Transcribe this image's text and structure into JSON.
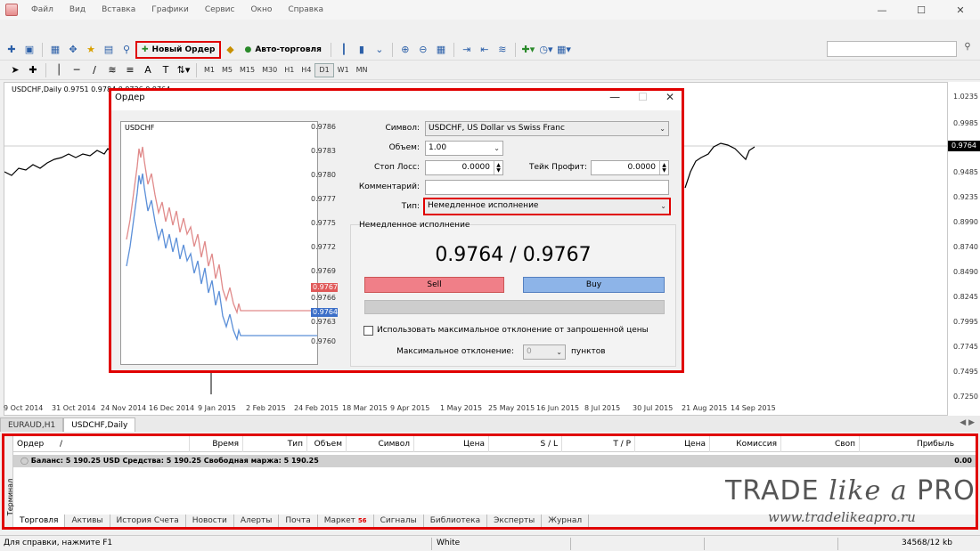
{
  "menu": [
    "Файл",
    "Вид",
    "Вставка",
    "Графики",
    "Сервис",
    "Окно",
    "Справка"
  ],
  "toolbar": {
    "new_order": "Новый Ордер",
    "auto_trading": "Авто-торговля",
    "timeframes": [
      "M1",
      "M5",
      "M15",
      "M30",
      "H1",
      "H4",
      "D1",
      "W1",
      "MN"
    ],
    "active_timeframe": "D1"
  },
  "chart": {
    "title": "USDCHF,Daily  0.9751 0.9784 0.9736 0.9764",
    "price_ticks": [
      "1.0235",
      "0.9985",
      "0.9764",
      "0.9485",
      "0.9235",
      "0.8990",
      "0.8740",
      "0.8490",
      "0.8245",
      "0.7995",
      "0.7745",
      "0.7495",
      "0.7250"
    ],
    "current_price": "0.9764",
    "dates": [
      "9 Oct 2014",
      "31 Oct 2014",
      "24 Nov 2014",
      "16 Dec 2014",
      "9 Jan 2015",
      "2 Feb 2015",
      "24 Feb 2015",
      "18 Mar 2015",
      "9 Apr 2015",
      "1 May 2015",
      "25 May 2015",
      "16 Jun 2015",
      "8 Jul 2015",
      "30 Jul 2015",
      "21 Aug 2015",
      "14 Sep 2015"
    ],
    "tabs": [
      "EURAUD,H1",
      "USDCHF,Daily"
    ],
    "active_tab": "USDCHF,Daily"
  },
  "dialog": {
    "title": "Ордер",
    "mini_chart": {
      "symbol": "USDCHF",
      "prices": [
        "0.9786",
        "0.9783",
        "0.9780",
        "0.9777",
        "0.9775",
        "0.9772",
        "0.9769",
        "0.9766",
        "0.9763",
        "0.9760"
      ],
      "ask": "0.9767",
      "bid": "0.9764"
    },
    "labels": {
      "symbol": "Символ:",
      "volume": "Объем:",
      "stop_loss": "Стоп Лосс:",
      "take_profit": "Тейк Профит:",
      "comment": "Комментарий:",
      "type": "Тип:"
    },
    "values": {
      "symbol": "USDCHF, US Dollar vs Swiss Franc",
      "volume": "1.00",
      "stop_loss": "0.0000",
      "take_profit": "0.0000",
      "comment": "",
      "type": "Немедленное исполнение"
    },
    "exec_group_label": "Немедленное исполнение",
    "quote": "0.9764 / 0.9767",
    "sell": "Sell",
    "buy": "Buy",
    "max_dev_checkbox": "Использовать максимальное отклонение от запрошенной цены",
    "max_dev_label": "Максимальное отклонение:",
    "max_dev_value": "0",
    "max_dev_unit": "пунктов"
  },
  "terminal": {
    "side_label": "Терминал",
    "columns": [
      "Ордер",
      "/",
      "Время",
      "Тип",
      "Объем",
      "Символ",
      "Цена",
      "S / L",
      "T / P",
      "Цена",
      "Комиссия",
      "Своп",
      "Прибыль"
    ],
    "balance_text": "Баланс: 5 190.25 USD  Средства: 5 190.25  Свободная маржа: 5 190.25",
    "balance_profit": "0.00",
    "tabs": [
      "Торговля",
      "Активы",
      "История Счета",
      "Новости",
      "Алерты",
      "Почта",
      "Маркет",
      "Сигналы",
      "Библиотека",
      "Эксперты",
      "Журнал"
    ],
    "market_badge": "56",
    "active_tab": "Торговля"
  },
  "watermark": {
    "brand_a": "TRADE ",
    "brand_b": "like a ",
    "brand_c": "PRO",
    "url": "www.tradelikeapro.ru"
  },
  "status": {
    "help": "Для справки, нажмите F1",
    "profile": "White",
    "traffic": "34568/12 kb"
  }
}
